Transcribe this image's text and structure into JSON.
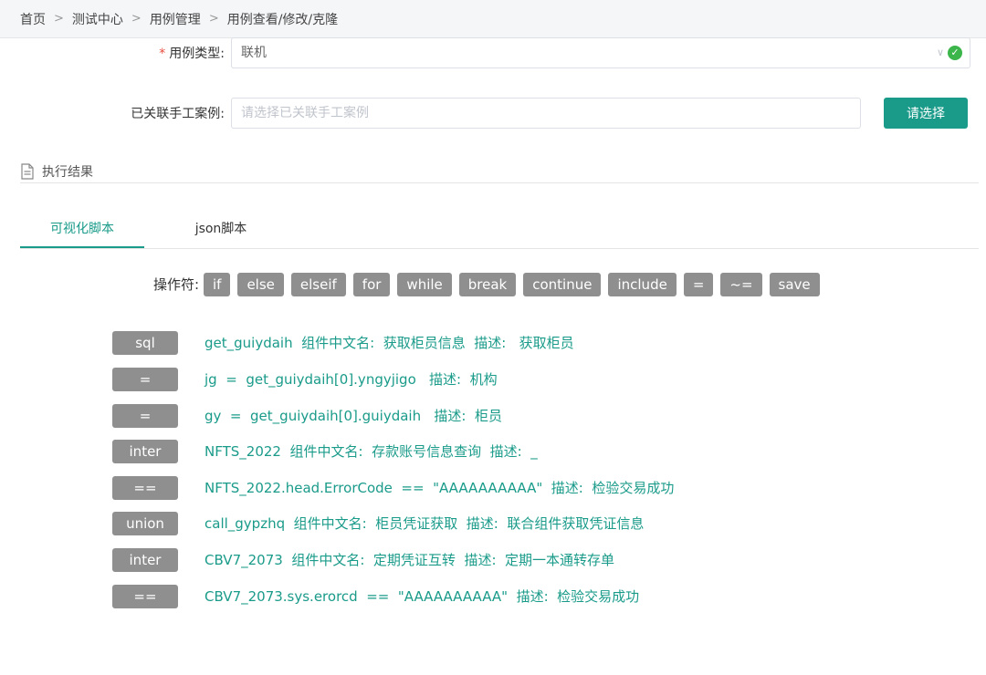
{
  "breadcrumb": {
    "items": [
      "首页",
      "测试中心",
      "用例管理",
      "用例查看/修改/克隆"
    ],
    "separator": ">"
  },
  "form": {
    "case_type": {
      "required_mark": "*",
      "label": "用例类型:",
      "value": "联机"
    },
    "linked_manual": {
      "label": "已关联手工案例:",
      "placeholder": "请选择已关联手工案例",
      "value": "",
      "button_label": "请选择"
    }
  },
  "section": {
    "title": "执行结果"
  },
  "tabs": [
    {
      "label": "可视化脚本",
      "active": true
    },
    {
      "label": "json脚本",
      "active": false
    }
  ],
  "operators": {
    "label": "操作符:",
    "items": [
      "if",
      "else",
      "elseif",
      "for",
      "while",
      "break",
      "continue",
      "include",
      "=",
      "~=",
      "save"
    ]
  },
  "steps": [
    {
      "tag": "sql",
      "text": "get_guiydaih  组件中文名:  获取柜员信息  描述:   获取柜员"
    },
    {
      "tag": "=",
      "text": "jg  =  get_guiydaih[0].yngyjigo   描述:  机构"
    },
    {
      "tag": "=",
      "text": "gy  =  get_guiydaih[0].guiydaih   描述:  柜员"
    },
    {
      "tag": "inter",
      "text": "NFTS_2022  组件中文名:  存款账号信息查询  描述:  _"
    },
    {
      "tag": "==",
      "text": "NFTS_2022.head.ErrorCode  ==  \"AAAAAAAAAA\"  描述:  检验交易成功"
    },
    {
      "tag": "union",
      "text": "call_gypzhq  组件中文名:  柜员凭证获取  描述:  联合组件获取凭证信息"
    },
    {
      "tag": "inter",
      "text": "CBV7_2073  组件中文名:  定期凭证互转  描述:  定期一本通转存单"
    },
    {
      "tag": "==",
      "text": "CBV7_2073.sys.erorcd  ==  \"AAAAAAAAAA\"  描述:  检验交易成功"
    }
  ],
  "colors": {
    "accent": "#1a9b8a",
    "tag_bg": "#8f8f8f",
    "required": "#e74c3c",
    "success": "#3cb54a"
  },
  "icons": {
    "dropdown": "chevron-down-icon",
    "valid": "check-circle-icon",
    "section": "document-icon"
  }
}
